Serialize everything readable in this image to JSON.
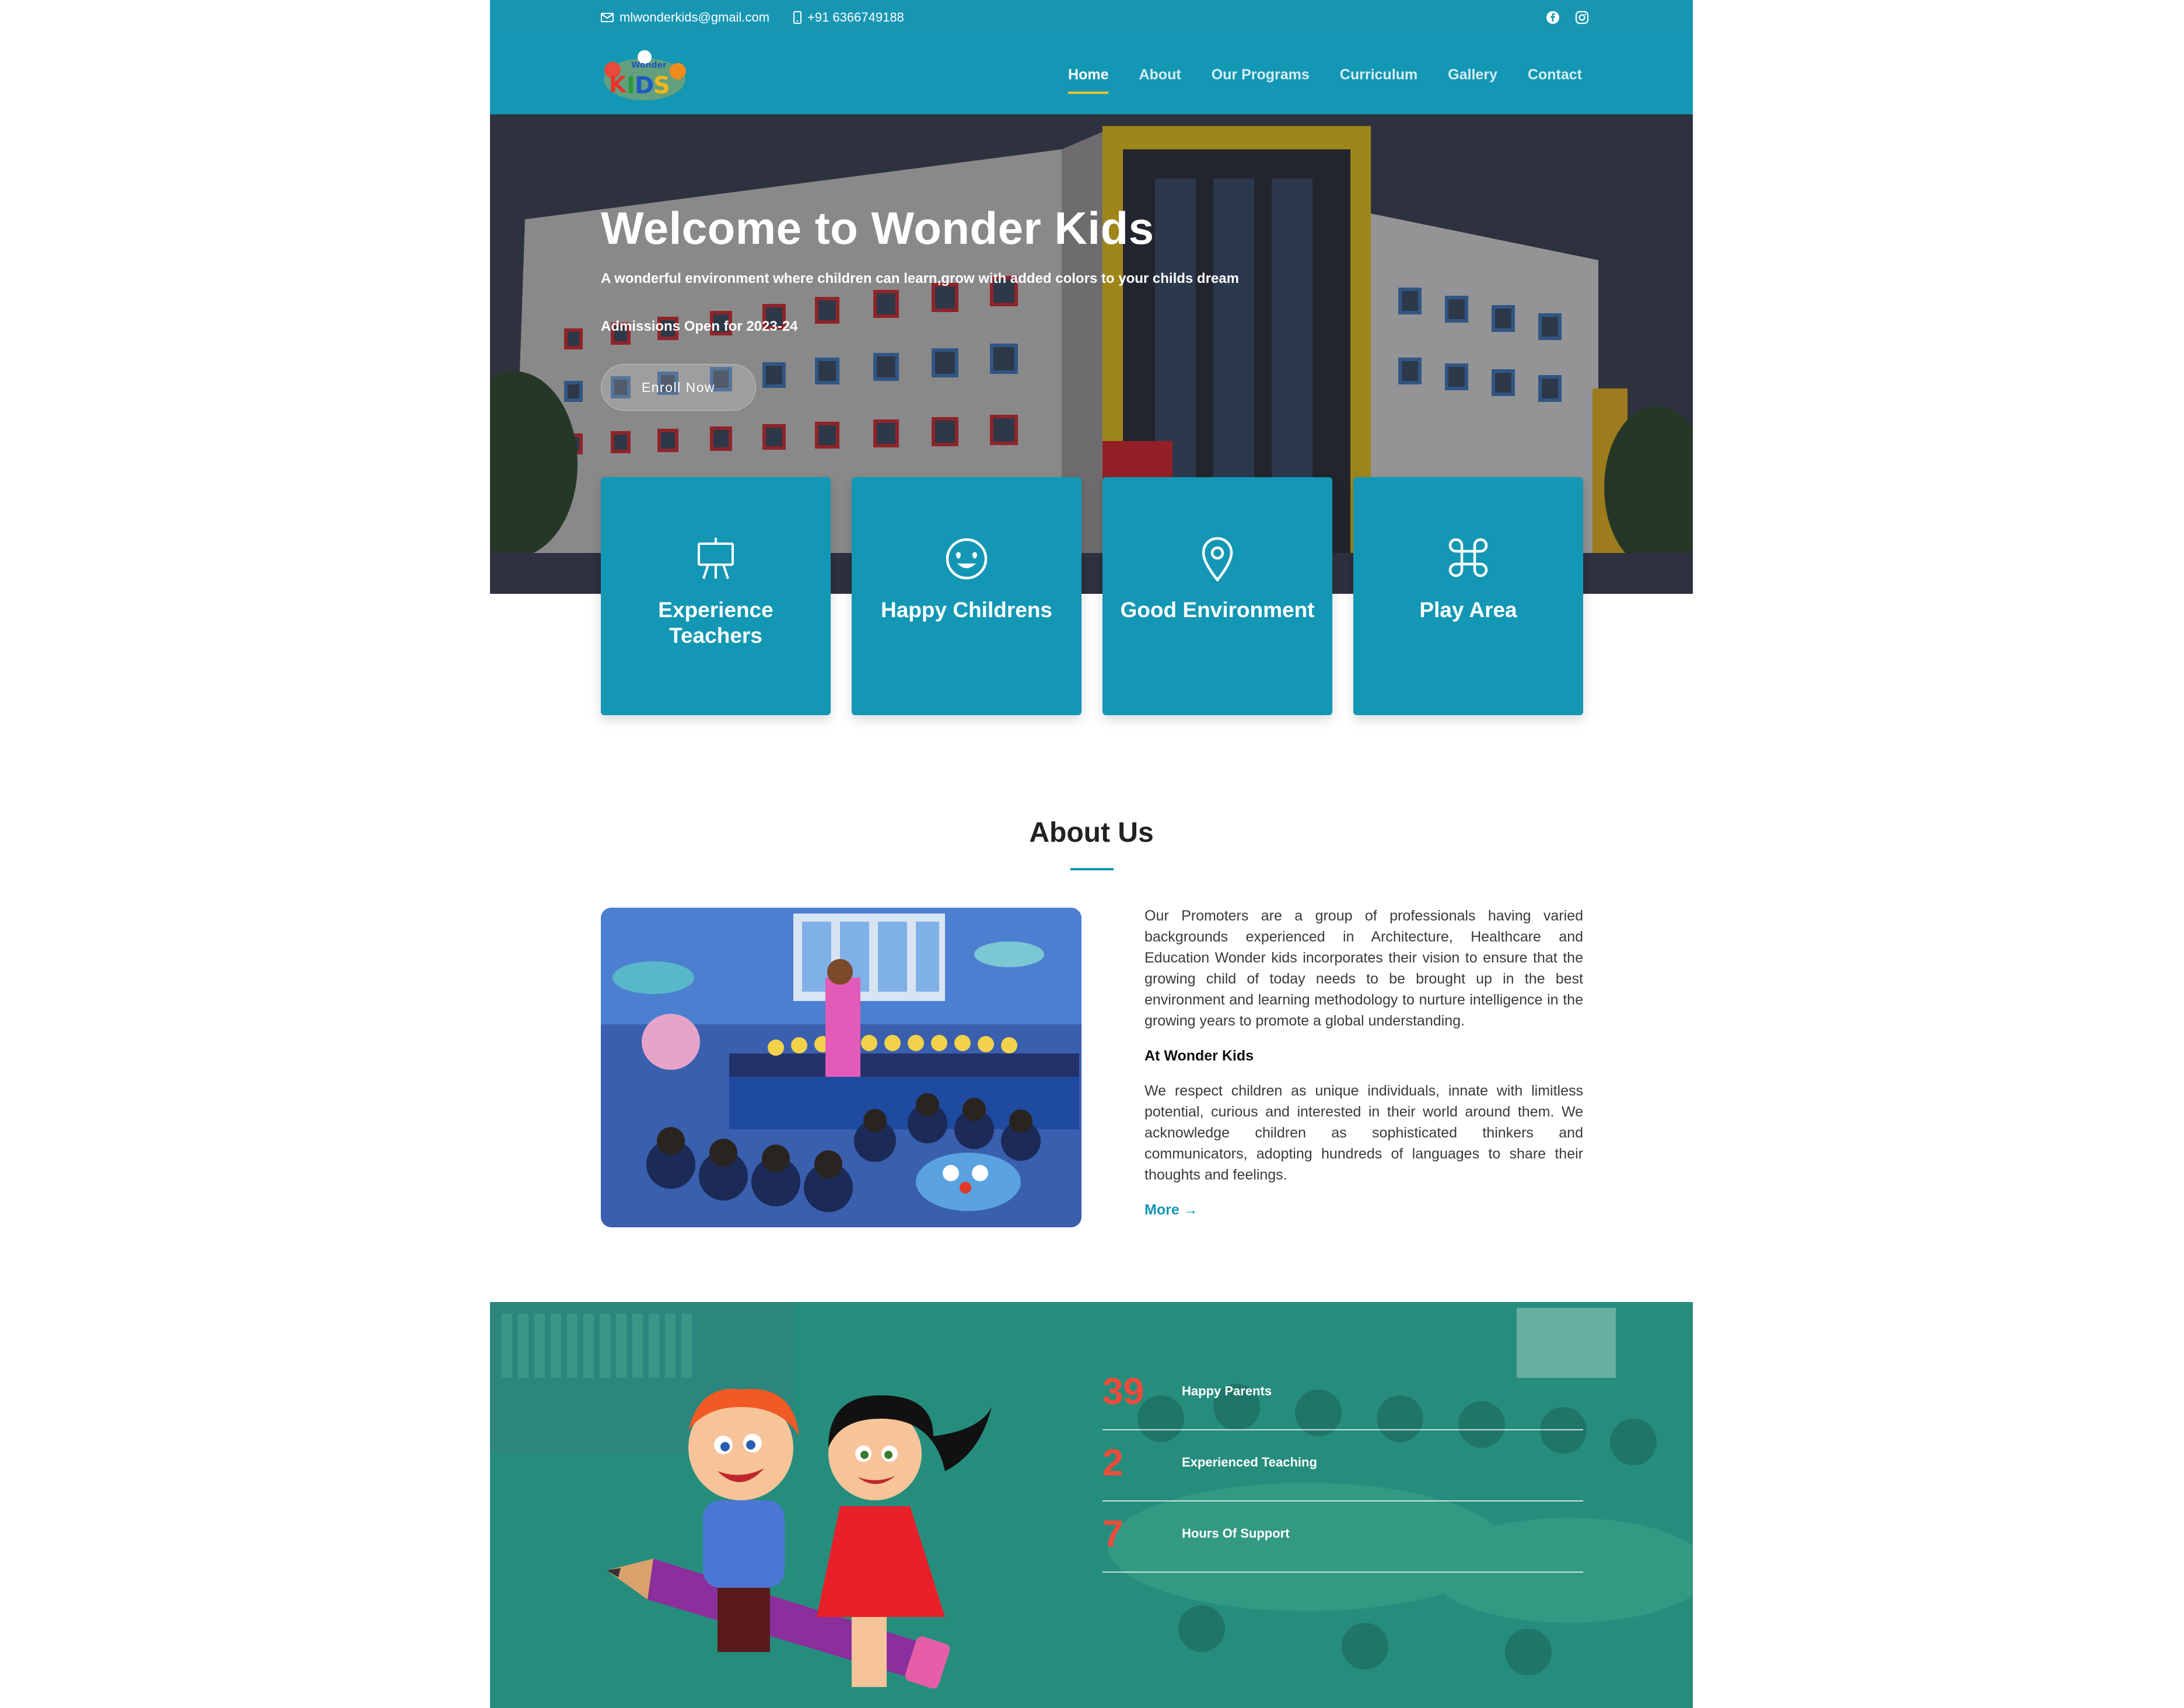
{
  "topbar": {
    "email": "mlwonderkids@gmail.com",
    "phone": "+91 6366749188",
    "social": [
      "facebook-icon",
      "instagram-icon"
    ]
  },
  "header": {
    "logo_text": "Wonder Kids",
    "nav": [
      "Home",
      "About",
      "Our Programs",
      "Curriculum",
      "Gallery",
      "Contact"
    ],
    "active": "Home"
  },
  "hero": {
    "title": "Welcome to Wonder Kids",
    "subtitle": "A wonderful environment where children can learn,grow with added colors to your childs dream",
    "admissions": "Admissions Open for 2023-24",
    "cta": "Enroll Now"
  },
  "features": [
    {
      "icon": "easel-icon",
      "label": "Experience Teachers"
    },
    {
      "icon": "smile-heart-eyes-icon",
      "label": "Happy Childrens"
    },
    {
      "icon": "map-pin-icon",
      "label": "Good Environment"
    },
    {
      "icon": "command-icon",
      "label": "Play Area"
    }
  ],
  "about": {
    "title": "About Us",
    "paragraph1": "Our Promoters are a group of professionals having varied backgrounds experienced in Architecture, Healthcare and Education Wonder kids incorporates their vision to ensure that the growing child of today needs to be brought up in the best environment and learning methodology to nurture intelligence in the growing years to promote a global understanding.",
    "subheading": "At Wonder Kids",
    "paragraph2": "We respect children as unique individuals, innate with limitless potential, curious and interested in their world around them. We acknowledge children as sophisticated thinkers and communicators, adopting hundreds of languages to share their thoughts and feelings.",
    "more": "More →"
  },
  "stats": [
    {
      "number": "39",
      "label": "Happy Parents"
    },
    {
      "number": "2",
      "label": "Experienced Teaching"
    },
    {
      "number": "7",
      "label": "Hours Of Support"
    }
  ],
  "colors": {
    "primary": "#1397b4",
    "accent_underline": "#f4c42c",
    "stat_number": "#ef4b3a",
    "stats_bg": "#2b8c7e"
  }
}
